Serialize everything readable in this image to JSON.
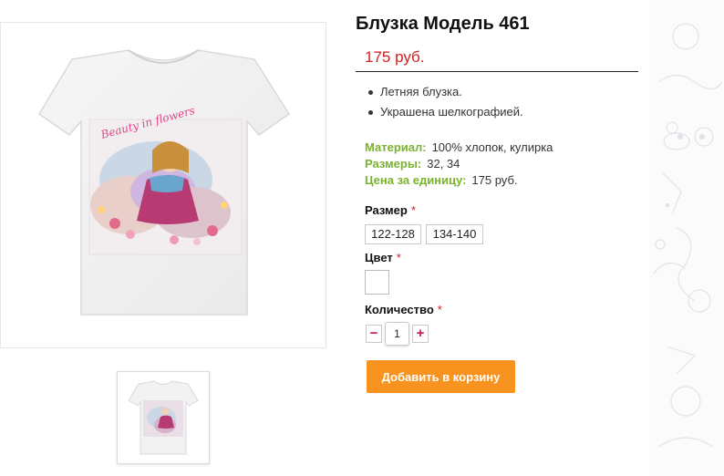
{
  "product": {
    "title": "Блузка Модель 461",
    "price": "175 руб.",
    "image_alt": "white-tshirt-photo",
    "features": [
      "Летняя блузка.",
      "Украшена шелкографией."
    ],
    "properties": [
      {
        "key": "Материал:",
        "value": "100% хлопок, кулирка"
      },
      {
        "key": "Размеры:",
        "value": "32, 34"
      },
      {
        "key": "Цена за единицу:",
        "value": "175 руб."
      }
    ]
  },
  "options": {
    "size": {
      "label": "Размер",
      "required_mark": "*",
      "values": [
        "122-128",
        "134-140"
      ]
    },
    "color": {
      "label": "Цвет",
      "required_mark": "*"
    },
    "quantity": {
      "label": "Количество",
      "required_mark": "*",
      "value": "1",
      "minus": "−",
      "plus": "+"
    }
  },
  "actions": {
    "add_to_cart": "Добавить в корзину"
  },
  "print_text": "Beauty in flowers",
  "colors": {
    "price": "#d11f1f",
    "property_key": "#7ab32e",
    "cta": "#f7931e",
    "stepper": "#c2185b"
  }
}
